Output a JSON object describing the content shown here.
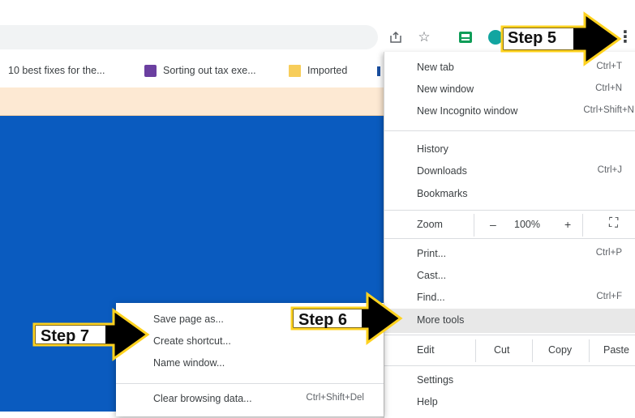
{
  "toolbar": {
    "share_icon": "share-icon",
    "star_icon": "star-icon",
    "ext_icon_1": "green-extension-icon",
    "ext_icon_2": "teal-extension-icon",
    "kebab": "⋮"
  },
  "bookmarks": [
    {
      "label": "10 best fixes for the...",
      "icon": "none"
    },
    {
      "label": "Sorting out tax exe...",
      "icon": "purple-logo-icon",
      "color": "#6b3fa0"
    },
    {
      "label": "Imported",
      "icon": "folder-icon",
      "color": "#f7cd5a"
    }
  ],
  "main_menu": {
    "new_tab": {
      "label": "New tab",
      "shortcut": "Ctrl+T"
    },
    "new_window": {
      "label": "New window",
      "shortcut": "Ctrl+N"
    },
    "new_incognito": {
      "label": "New Incognito window",
      "shortcut": "Ctrl+Shift+N"
    },
    "history": {
      "label": "History"
    },
    "downloads": {
      "label": "Downloads",
      "shortcut": "Ctrl+J"
    },
    "bookmarks": {
      "label": "Bookmarks"
    },
    "zoom": {
      "label": "Zoom",
      "minus": "–",
      "value": "100%",
      "plus": "+",
      "fullscreen": "⛶"
    },
    "print": {
      "label": "Print...",
      "shortcut": "Ctrl+P"
    },
    "cast": {
      "label": "Cast..."
    },
    "find": {
      "label": "Find...",
      "shortcut": "Ctrl+F"
    },
    "more_tools": {
      "label": "More tools"
    },
    "edit": {
      "label": "Edit",
      "cut": "Cut",
      "copy": "Copy",
      "paste": "Paste"
    },
    "settings": {
      "label": "Settings"
    },
    "help": {
      "label": "Help"
    }
  },
  "submenu": {
    "save_page": {
      "label": "Save page as..."
    },
    "create_shortcut": {
      "label": "Create shortcut..."
    },
    "name_window": {
      "label": "Name window..."
    },
    "clear_browsing": {
      "label": "Clear browsing data...",
      "shortcut": "Ctrl+Shift+Del"
    }
  },
  "steps": {
    "step5": "Step 5",
    "step6": "Step 6",
    "step7": "Step 7"
  },
  "colors": {
    "page_blue": "#0a5bbf",
    "notice_bg": "#fde9d3",
    "callout_fill": "#000000",
    "callout_border": "#ffd21f",
    "hover": "#e8e8e8"
  }
}
